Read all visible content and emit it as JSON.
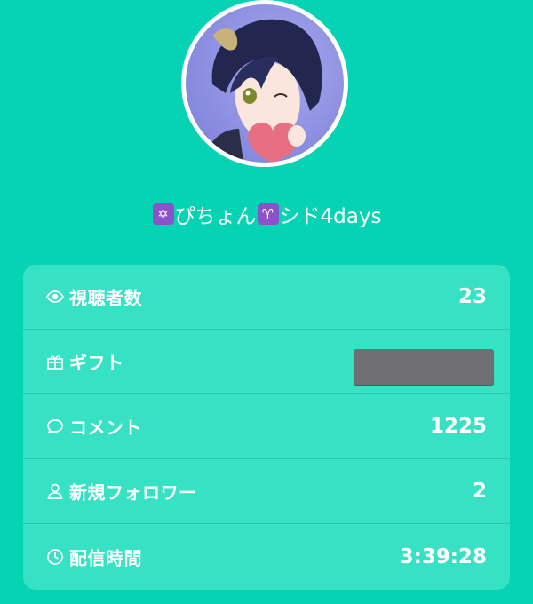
{
  "profile": {
    "name_part1": "ぴちょん",
    "name_part2": "シド4days",
    "emoji_star": "✡",
    "emoji_aries": "♈"
  },
  "stats": {
    "viewers": {
      "label": "視聴者数",
      "value": "23",
      "icon": "eye-icon"
    },
    "gifts": {
      "label": "ギフト",
      "value": "",
      "icon": "gift-icon"
    },
    "comments": {
      "label": "コメント",
      "value": "1225",
      "icon": "comment-icon"
    },
    "followers": {
      "label": "新規フォロワー",
      "value": "2",
      "icon": "person-icon"
    },
    "duration": {
      "label": "配信時間",
      "value": "3:39:28",
      "icon": "clock-icon"
    }
  },
  "colors": {
    "background": "#06d3b4",
    "card": "#37e1c4",
    "emoji_bg": "#8b52c9"
  }
}
